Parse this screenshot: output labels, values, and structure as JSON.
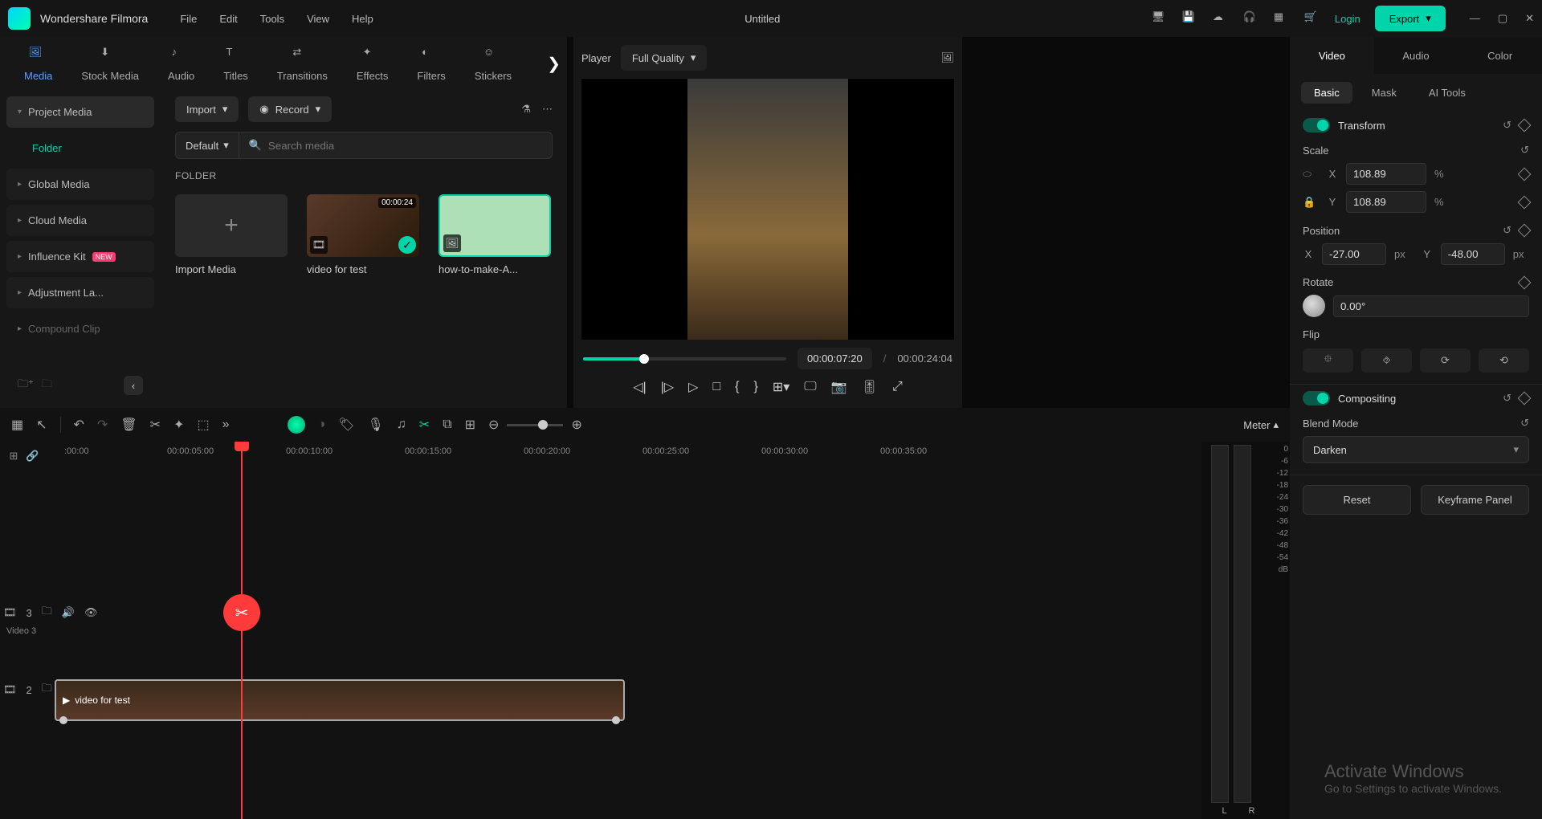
{
  "app": {
    "name": "Wondershare Filmora",
    "title": "Untitled"
  },
  "menubar": [
    "File",
    "Edit",
    "Tools",
    "View",
    "Help"
  ],
  "titlebar": {
    "login": "Login",
    "export": "Export"
  },
  "mediaTabs": [
    "Media",
    "Stock Media",
    "Audio",
    "Titles",
    "Transitions",
    "Effects",
    "Filters",
    "Stickers"
  ],
  "mediaSidebar": {
    "items": [
      {
        "label": "Project Media",
        "expanded": true
      },
      {
        "label": "Folder",
        "active": true,
        "child": true
      },
      {
        "label": "Global Media"
      },
      {
        "label": "Cloud Media"
      },
      {
        "label": "Influence Kit",
        "badge": "NEW"
      },
      {
        "label": "Adjustment La..."
      },
      {
        "label": "Compound Clip"
      }
    ]
  },
  "mediaToolbar": {
    "import": "Import",
    "record": "Record",
    "sort": "Default",
    "searchPlaceholder": "Search media"
  },
  "mediaHeading": "FOLDER",
  "mediaCards": [
    {
      "label": "Import Media",
      "kind": "import"
    },
    {
      "label": "video for test",
      "kind": "vid",
      "duration": "00:00:24"
    },
    {
      "label": "how-to-make-A...",
      "kind": "howto"
    }
  ],
  "preview": {
    "playerLabel": "Player",
    "quality": "Full Quality",
    "current": "00:00:07:20",
    "total": "00:00:24:04"
  },
  "inspector": {
    "tabs": [
      "Video",
      "Audio",
      "Color"
    ],
    "subtabs": [
      "Basic",
      "Mask",
      "AI Tools"
    ],
    "transform": {
      "title": "Transform"
    },
    "scale": {
      "label": "Scale",
      "x": "108.89",
      "y": "108.89",
      "unit": "%"
    },
    "position": {
      "label": "Position",
      "x": "-27.00",
      "y": "-48.00",
      "unit": "px"
    },
    "rotate": {
      "label": "Rotate",
      "value": "0.00°"
    },
    "flip": {
      "label": "Flip"
    },
    "compositing": {
      "title": "Compositing"
    },
    "blend": {
      "label": "Blend Mode",
      "value": "Darken"
    },
    "footer": {
      "reset": "Reset",
      "keyframe": "Keyframe Panel"
    }
  },
  "timeline": {
    "meter": "Meter",
    "ticks": [
      ":00:00",
      "00:00:05:00",
      "00:00:10:00",
      "00:00:15:00",
      "00:00:20:00",
      "00:00:25:00",
      "00:00:30:00",
      "00:00:35:00"
    ],
    "track3": {
      "num": "3",
      "label": "Video 3"
    },
    "track2": {
      "num": "2"
    },
    "clip": "video for test",
    "meterLabels": [
      "0",
      "-6",
      "-12",
      "-18",
      "-24",
      "-30",
      "-36",
      "-42",
      "-48",
      "-54",
      "dB"
    ],
    "lr": [
      "L",
      "R"
    ]
  },
  "watermark": {
    "line1": "Activate Windows",
    "line2": "Go to Settings to activate Windows."
  }
}
